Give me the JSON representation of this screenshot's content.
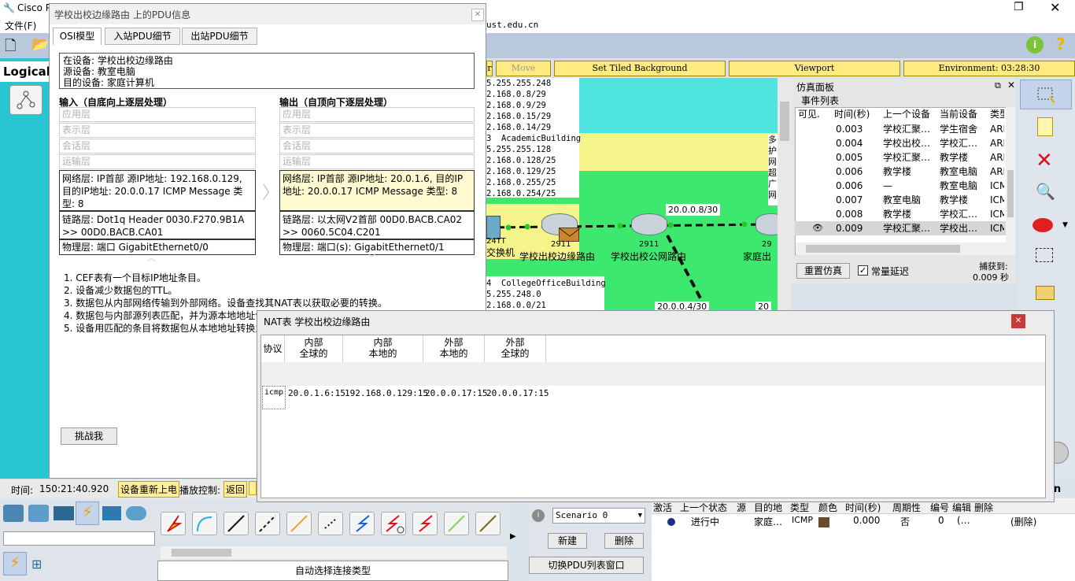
{
  "app": {
    "title": "Cisco P",
    "menu_file": "文件(F)",
    "url_fragment": "ust.edu.cn",
    "logical_label": "Logical"
  },
  "workspace": {
    "buttons": [
      "r",
      "Move Object",
      "Set Tiled Background",
      "Viewport",
      "Environment: 03:28:30"
    ]
  },
  "canvas": {
    "ip_list": [
      "5.255.255.248",
      "2.168.0.8/29",
      "2.168.0.9/29",
      "2.168.0.15/29",
      "2.168.0.14/29",
      "3  AcademicBuilding",
      "5.255.255.128",
      "2.168.0.128/25",
      "2.168.0.129/25",
      "2.168.0.255/25",
      "2.168.0.254/25"
    ],
    "ip_list2": [
      "4  CollegeOfficeBuilding",
      "5.255.248.0",
      "2.168.0.0/21"
    ],
    "link_label1": "20.0.0.8/30",
    "link_label2": "20.0.0.4/30",
    "link_label3": "20",
    "devices": [
      {
        "model": "24TT",
        "name": "交换机"
      },
      {
        "model": "2911",
        "name": "学校出校边缘路由"
      },
      {
        "model": "2911",
        "name": "学校出校公网路由"
      },
      {
        "model": "29",
        "name": "家庭出"
      }
    ],
    "side_chars": "多\n护\n网\n超\n广\n网"
  },
  "sim_panel": {
    "title": "仿真面板",
    "events_label": "事件列表",
    "columns": [
      "可见.",
      "时间(秒)",
      "上一个设备",
      "当前设备",
      "类型"
    ],
    "rows": [
      {
        "time": "0.003",
        "prev": "学校汇聚…",
        "cur": "学生宿舍",
        "type": "ARP"
      },
      {
        "time": "0.004",
        "prev": "学校出校…",
        "cur": "学校汇…",
        "type": "ARP"
      },
      {
        "time": "0.005",
        "prev": "学校汇聚…",
        "cur": "教学楼",
        "type": "ARP"
      },
      {
        "time": "0.006",
        "prev": "教学楼",
        "cur": "教室电脑",
        "type": "ARP"
      },
      {
        "time": "0.006",
        "prev": "—",
        "cur": "教室电脑",
        "type": "ICMP"
      },
      {
        "time": "0.007",
        "prev": "教室电脑",
        "cur": "教学楼",
        "type": "ICMP"
      },
      {
        "time": "0.008",
        "prev": "教学楼",
        "cur": "学校汇…",
        "type": "ICMP"
      },
      {
        "time": "0.009",
        "prev": "学校汇聚…",
        "cur": "学校出…",
        "type": "ICMP"
      }
    ],
    "reset_btn": "重置仿真",
    "const_delay": "常量延迟",
    "captured_label": "捕获到:",
    "captured_value": "0.009 秒"
  },
  "pdu_dialog": {
    "title": "学校出校边缘路由 上的PDU信息",
    "tabs": [
      "OSI模型",
      "入站PDU细节",
      "出站PDU细节"
    ],
    "info": [
      "在设备: 学校出校边缘路由",
      "源设备: 教室电脑",
      "目的设备: 家庭计算机"
    ],
    "in_title": "输入（自底向上逐层处理）",
    "out_title": "输出（自顶向下逐层处理）",
    "layers_gray": [
      "应用层",
      "表示层",
      "会话层",
      "运输层"
    ],
    "in_net": "网络层: IP首部 源IP地址: 192.168.0.129, 目的IP地址: 20.0.0.17 ICMP Message 类型: 8",
    "in_link": "链路层: Dot1q Header 0030.F270.9B1A >> 00D0.BACB.CA01",
    "in_phys": "物理层: 端口 GigabitEthernet0/0",
    "out_net": "网络层: IP首部 源IP地址: 20.0.1.6, 目的IP地址: 20.0.0.17 ICMP Message 类型: 8",
    "out_link": "链路层: 以太网V2首部 00D0.BACB.CA02 >> 0060.5C04.C201",
    "out_phys": "物理层: 端口(s): GigabitEthernet0/1",
    "steps": [
      "1. CEF表有一个目标IP地址条目。",
      "2. 设备减少数据包的TTL。",
      "3. 数据包从内部网络传输到外部网络。设备查找其NAT表以获取必要的转换。",
      "4. 数据包与内部源列表匹配，并为源本地地址创",
      "5. 设备用匹配的条目将数据包从本地地址转换为"
    ],
    "challenge": "挑战我"
  },
  "nat_dialog": {
    "title": "NAT表 学校出校边缘路由",
    "headers": [
      "协议",
      "内部\n全球的",
      "内部\n本地的",
      "外部\n本地的",
      "外部\n全球的"
    ],
    "row": [
      "icmp",
      "20.0.1.6:15",
      "192.168.0.129:15",
      "20.0.0.17:15",
      "20.0.0.17:15"
    ]
  },
  "status": {
    "time_label": "时间:",
    "time_value": "150:21:40.920",
    "power_cycle": "设备重新上电",
    "playback": "播放控制:",
    "back": "返回",
    "auto_conn": "自动选择连接类型"
  },
  "scenario": {
    "selected": "Scenario 0",
    "new": "新建",
    "delete": "删除",
    "toggle": "切换PDU列表窗口"
  },
  "pdu_list": {
    "columns": [
      "激活",
      "上一个状态",
      "源",
      "目的地",
      "类型",
      "颜色",
      "时间(秒)",
      "周期性",
      "编号",
      "编辑",
      "删除"
    ],
    "row": {
      "state": "进行中",
      "src": "",
      "dst": "家庭…",
      "type": "ICMP",
      "time": "0.000",
      "periodic": "否",
      "num": "0",
      "edit": "(…",
      "del": "(删除)"
    }
  },
  "colors": {
    "accent_yellow": "#ffeb80",
    "canvas_green": "#3de86e",
    "canvas_cyan": "#4fe4e0",
    "sidebar_cyan": "#28c5d2"
  }
}
